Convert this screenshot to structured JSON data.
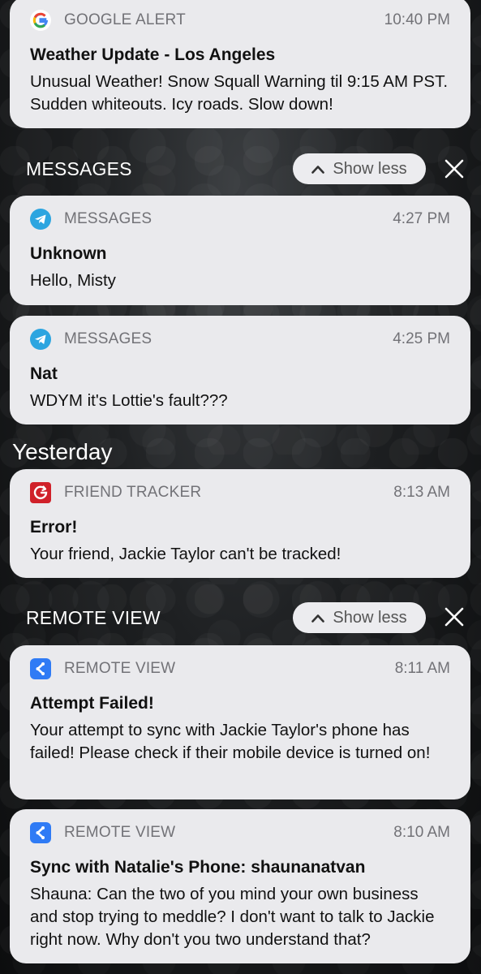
{
  "notifications": [
    {
      "app": "GOOGLE ALERT",
      "time": "10:40 PM",
      "title": "Weather Update - Los Angeles",
      "body": "Unusual Weather! Snow Squall Warning til 9:15 AM PST. Sudden whiteouts. Icy roads. Slow down!",
      "icon": "google-icon"
    },
    {
      "app": "MESSAGES",
      "time": "4:27 PM",
      "title": "Unknown",
      "body": "Hello, Misty",
      "icon": "telegram-icon"
    },
    {
      "app": "MESSAGES",
      "time": "4:25 PM",
      "title": "Nat",
      "body": "WDYM it's Lottie's fault???",
      "icon": "telegram-icon"
    },
    {
      "app": "FRIEND TRACKER",
      "time": "8:13 AM",
      "title": "Error!",
      "body": "Your friend, Jackie Taylor can't be tracked!",
      "icon": "friend-tracker-icon"
    },
    {
      "app": "REMOTE VIEW",
      "time": "8:11 AM",
      "title": "Attempt Failed!",
      "body": "Your attempt to sync with Jackie Taylor's phone has failed! Please check if their mobile device is turned on!",
      "icon": "remote-view-icon"
    },
    {
      "app": "REMOTE VIEW",
      "time": "8:10 AM",
      "title": "Sync with Natalie's Phone: shaunanatvan",
      "body": "Shauna: Can the two of you mind your own business and stop trying to meddle? I don't want to talk to Jackie right now. Why don't you two understand that?",
      "icon": "remote-view-icon"
    }
  ],
  "groups": {
    "messages": {
      "label": "MESSAGES",
      "show_less": "Show less"
    },
    "remote_view": {
      "label": "REMOTE VIEW",
      "show_less": "Show less"
    }
  },
  "sections": {
    "yesterday": "Yesterday"
  },
  "colors": {
    "card_bg": "#eaeaed",
    "telegram": "#2ca5e0",
    "friend_tracker": "#d0212a",
    "remote_view": "#2f7bf5"
  }
}
